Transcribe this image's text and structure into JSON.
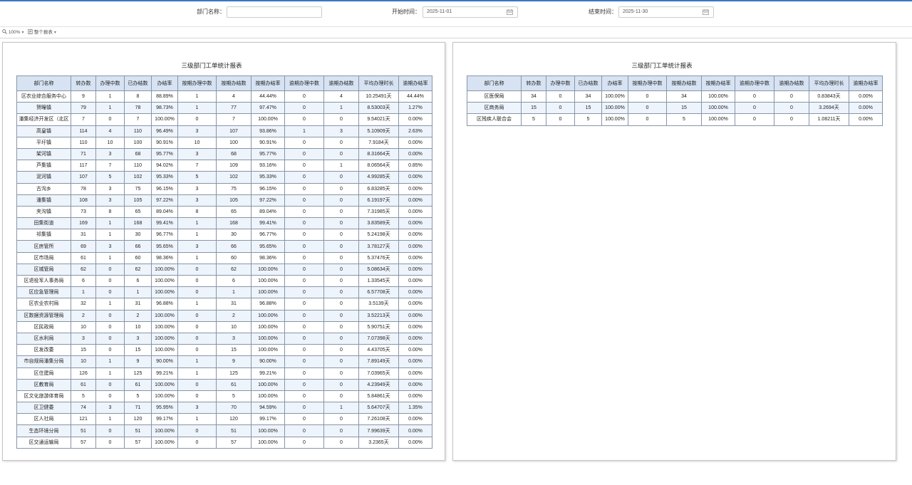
{
  "filters": {
    "department": {
      "label": "部门名称：",
      "value": ""
    },
    "start_date": {
      "label": "开始时间：",
      "value": "2025-11-01",
      "icon": "calendar-icon"
    },
    "end_date": {
      "label": "结束时间：",
      "value": "2025-11-30",
      "icon": "calendar-icon"
    }
  },
  "toolbar": {
    "zoom": {
      "value": "100%",
      "icon": "zoom-icon"
    },
    "view": {
      "value": "整个报表",
      "icon": "report-page-icon"
    }
  },
  "colors": {
    "accent": "#3a78c2",
    "header_bg": "#d7e3f2",
    "row_alt_bg": "#eef4fb",
    "grid": "#8795a6"
  },
  "columns": [
    "部门名称",
    "转办数",
    "办理中数",
    "已办结数",
    "办结率",
    "按期办理中数",
    "按期办结数",
    "按期办结率",
    "逾期办理中数",
    "逾期办结数",
    "平均办理时长",
    "逾期办结率"
  ],
  "reports": [
    {
      "title": "三级部门工单统计报表",
      "rows": [
        [
          "区农业综合服务中心",
          9,
          1,
          8,
          "88.89%",
          1,
          4,
          "44.44%",
          0,
          4,
          "10.25491天",
          "44.44%"
        ],
        [
          "贺疃镇",
          79,
          1,
          78,
          "98.73%",
          1,
          77,
          "97.47%",
          0,
          1,
          "8.53003天",
          "1.27%"
        ],
        [
          "潘集经济开发区（北区",
          7,
          0,
          7,
          "100.00%",
          0,
          7,
          "100.00%",
          0,
          0,
          "9.54021天",
          "0.00%"
        ],
        [
          "高皇镇",
          114,
          4,
          110,
          "96.49%",
          3,
          107,
          "93.86%",
          1,
          3,
          "5.10909天",
          "2.63%"
        ],
        [
          "平圩镇",
          110,
          10,
          100,
          "90.91%",
          10,
          100,
          "90.91%",
          0,
          0,
          "7.9184天",
          "0.00%"
        ],
        [
          "架河镇",
          71,
          3,
          68,
          "95.77%",
          3,
          68,
          "95.77%",
          0,
          0,
          "8.31664天",
          "0.00%"
        ],
        [
          "芦集镇",
          117,
          7,
          110,
          "94.02%",
          7,
          109,
          "93.16%",
          0,
          1,
          "8.06564天",
          "0.85%"
        ],
        [
          "泥河镇",
          107,
          5,
          102,
          "95.33%",
          5,
          102,
          "95.33%",
          0,
          0,
          "4.99285天",
          "0.00%"
        ],
        [
          "古沟乡",
          78,
          3,
          75,
          "96.15%",
          3,
          75,
          "96.15%",
          0,
          0,
          "6.83285天",
          "0.00%"
        ],
        [
          "潘集镇",
          108,
          3,
          105,
          "97.22%",
          3,
          105,
          "97.22%",
          0,
          0,
          "6.19197天",
          "0.00%"
        ],
        [
          "夹沟镇",
          73,
          8,
          65,
          "89.04%",
          8,
          65,
          "89.04%",
          0,
          0,
          "7.31985天",
          "0.00%"
        ],
        [
          "田集街道",
          169,
          1,
          168,
          "99.41%",
          1,
          168,
          "99.41%",
          0,
          0,
          "3.83589天",
          "0.00%"
        ],
        [
          "祁集镇",
          31,
          1,
          30,
          "96.77%",
          1,
          30,
          "96.77%",
          0,
          0,
          "5.24198天",
          "0.00%"
        ],
        [
          "区房管所",
          69,
          3,
          66,
          "95.65%",
          3,
          66,
          "95.65%",
          0,
          0,
          "3.78127天",
          "0.00%"
        ],
        [
          "区市场局",
          61,
          1,
          60,
          "98.36%",
          1,
          60,
          "98.36%",
          0,
          0,
          "5.37476天",
          "0.00%"
        ],
        [
          "区城管局",
          62,
          0,
          62,
          "100.00%",
          0,
          62,
          "100.00%",
          0,
          0,
          "5.08634天",
          "0.00%"
        ],
        [
          "区退役军人事务局",
          6,
          0,
          6,
          "100.00%",
          0,
          6,
          "100.00%",
          0,
          0,
          "1.33545天",
          "0.00%"
        ],
        [
          "区应急管理局",
          1,
          0,
          1,
          "100.00%",
          0,
          1,
          "100.00%",
          0,
          0,
          "6.57708天",
          "0.00%"
        ],
        [
          "区农业农村局",
          32,
          1,
          31,
          "96.88%",
          1,
          31,
          "96.88%",
          0,
          0,
          "3.5139天",
          "0.00%"
        ],
        [
          "区数据资源管理局",
          2,
          0,
          2,
          "100.00%",
          0,
          2,
          "100.00%",
          0,
          0,
          "3.52213天",
          "0.00%"
        ],
        [
          "区民政局",
          10,
          0,
          10,
          "100.00%",
          0,
          10,
          "100.00%",
          0,
          0,
          "5.90751天",
          "0.00%"
        ],
        [
          "区水利局",
          3,
          0,
          3,
          "100.00%",
          0,
          3,
          "100.00%",
          0,
          0,
          "7.07398天",
          "0.00%"
        ],
        [
          "区发改委",
          15,
          0,
          15,
          "100.00%",
          0,
          15,
          "100.00%",
          0,
          0,
          "4.43705天",
          "0.00%"
        ],
        [
          "市自规局潘集分局",
          10,
          1,
          9,
          "90.00%",
          1,
          9,
          "90.00%",
          0,
          0,
          "7.89149天",
          "0.00%"
        ],
        [
          "区住建局",
          126,
          1,
          125,
          "99.21%",
          1,
          125,
          "99.21%",
          0,
          0,
          "7.03965天",
          "0.00%"
        ],
        [
          "区教育局",
          61,
          0,
          61,
          "100.00%",
          0,
          61,
          "100.00%",
          0,
          0,
          "4.23949天",
          "0.00%"
        ],
        [
          "区文化旅游体育局",
          5,
          0,
          5,
          "100.00%",
          0,
          5,
          "100.00%",
          0,
          0,
          "5.84861天",
          "0.00%"
        ],
        [
          "区卫健委",
          74,
          3,
          71,
          "95.95%",
          3,
          70,
          "94.59%",
          0,
          1,
          "5.64707天",
          "1.35%"
        ],
        [
          "区人社局",
          121,
          1,
          120,
          "99.17%",
          1,
          120,
          "99.17%",
          0,
          0,
          "7.26108天",
          "0.00%"
        ],
        [
          "生态环境分局",
          51,
          0,
          51,
          "100.00%",
          0,
          51,
          "100.00%",
          0,
          0,
          "7.99639天",
          "0.00%"
        ],
        [
          "区交通运输局",
          57,
          0,
          57,
          "100.00%",
          0,
          57,
          "100.00%",
          0,
          0,
          "3.2365天",
          "0.00%"
        ]
      ]
    },
    {
      "title": "三级部门工单统计报表",
      "rows": [
        [
          "区医保局",
          34,
          0,
          34,
          "100.00%",
          0,
          34,
          "100.00%",
          0,
          0,
          "0.83843天",
          "0.00%"
        ],
        [
          "区商务局",
          15,
          0,
          15,
          "100.00%",
          0,
          15,
          "100.00%",
          0,
          0,
          "3.2694天",
          "0.00%"
        ],
        [
          "区残疾人联合会",
          5,
          0,
          5,
          "100.00%",
          0,
          5,
          "100.00%",
          0,
          0,
          "1.08211天",
          "0.00%"
        ]
      ]
    }
  ]
}
